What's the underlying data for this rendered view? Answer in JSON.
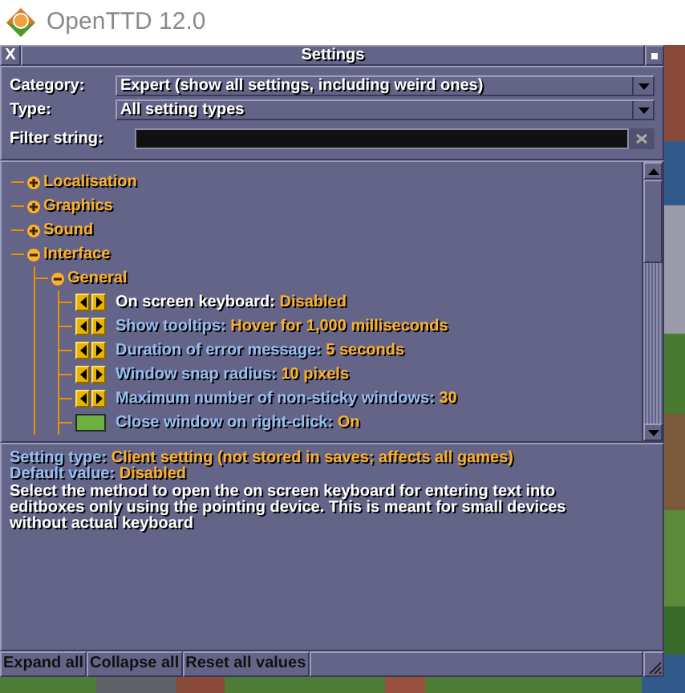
{
  "app_title": "OpenTTD 12.0",
  "window": {
    "close": "X",
    "title": "Settings"
  },
  "filters": [
    {
      "label": "Category:",
      "value": "Expert (show all settings, including weird ones)"
    },
    {
      "label": "Type:",
      "value": "All setting types"
    }
  ],
  "filter_string": {
    "label": "Filter string:"
  },
  "tree": [
    {
      "label": "Localisation",
      "expanded": false
    },
    {
      "label": "Graphics",
      "expanded": false
    },
    {
      "label": "Sound",
      "expanded": false
    },
    {
      "label": "Interface",
      "expanded": true,
      "children": [
        {
          "label": "General",
          "expanded": true,
          "children": [
            {
              "kind": "stepper",
              "name": "On screen keyboard:",
              "value": "Disabled",
              "selected": true
            },
            {
              "kind": "stepper",
              "name": "Show tooltips:",
              "value": "Hover for 1,000 milliseconds",
              "selected": false
            },
            {
              "kind": "stepper",
              "name": "Duration of error message:",
              "value": "5 seconds",
              "selected": false
            },
            {
              "kind": "stepper",
              "name": "Window snap radius:",
              "value": "10 pixels",
              "selected": false
            },
            {
              "kind": "stepper",
              "name": "Maximum number of non-sticky windows:",
              "value": "30",
              "selected": false
            },
            {
              "kind": "toggle",
              "name": "Close window on right-click:",
              "value": "On",
              "on": true,
              "selected": false
            }
          ]
        }
      ]
    }
  ],
  "description": {
    "type_label": "Setting type:",
    "type_value": "Client setting (not stored in saves; affects all games)",
    "default_label": "Default value:",
    "default_value": "Disabled",
    "text": "Select the method to open the on screen keyboard for entering text into editboxes only using the pointing device. This is meant for small devices without actual keyboard"
  },
  "buttons": [
    "Expand all",
    "Collapse all",
    "Reset all values"
  ]
}
